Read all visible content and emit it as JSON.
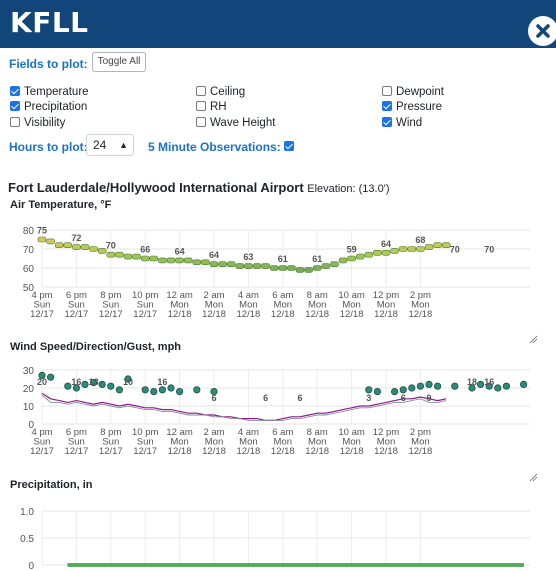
{
  "header": {
    "title": "KFLL",
    "close_icon": "close-circle-icon"
  },
  "fields": {
    "label": "Fields to plot:",
    "toggle_label": "Toggle All",
    "items": [
      {
        "label": "Temperature",
        "checked": true
      },
      {
        "label": "Ceiling",
        "checked": false
      },
      {
        "label": "Dewpoint",
        "checked": false
      },
      {
        "label": "Precipitation",
        "checked": true
      },
      {
        "label": "RH",
        "checked": false
      },
      {
        "label": "Pressure",
        "checked": true
      },
      {
        "label": "Visibility",
        "checked": false
      },
      {
        "label": "Wave Height",
        "checked": false
      },
      {
        "label": "Wind",
        "checked": true
      }
    ]
  },
  "hours": {
    "label": "Hours to plot:",
    "value": "24",
    "five_min_label": "5 Minute Observations:",
    "five_min_checked": true
  },
  "station": {
    "name": "Fort Lauderdale/Hollywood International Airport",
    "elevation": "Elevation: (13.0')"
  },
  "x_ticks": [
    [
      "4 pm",
      "Sun",
      "12/17"
    ],
    [
      "6 pm",
      "Sun",
      "12/17"
    ],
    [
      "8 pm",
      "Sun",
      "12/17"
    ],
    [
      "10 pm",
      "Sun",
      "12/17"
    ],
    [
      "12 am",
      "Mon",
      "12/18"
    ],
    [
      "2 am",
      "Mon",
      "12/18"
    ],
    [
      "4 am",
      "Mon",
      "12/18"
    ],
    [
      "6 am",
      "Mon",
      "12/18"
    ],
    [
      "8 am",
      "Mon",
      "12/18"
    ],
    [
      "10 am",
      "Mon",
      "12/18"
    ],
    [
      "12 pm",
      "Mon",
      "12/18"
    ],
    [
      "2 pm",
      "Mon",
      "12/18"
    ]
  ],
  "chart_data": [
    {
      "type": "scatter",
      "title": "Air Temperature, °F",
      "ylim": [
        50,
        80
      ],
      "yticks": [
        50,
        60,
        70,
        80
      ],
      "x_hours": [
        0,
        0.5,
        1,
        1.5,
        2,
        2.5,
        3,
        3.5,
        4,
        4.5,
        5,
        5.5,
        6,
        6.5,
        7,
        7.5,
        8,
        8.5,
        9,
        9.5,
        10,
        10.5,
        11,
        11.5,
        12,
        12.5,
        13,
        13.5,
        14,
        14.5,
        15,
        15.5,
        16,
        16.5,
        17,
        17.5,
        18,
        18.5,
        19,
        19.5,
        20,
        20.5,
        21,
        21.5,
        22,
        22.5,
        23,
        23.5
      ],
      "values": [
        75,
        74,
        72,
        72,
        71,
        71,
        70,
        69,
        67,
        67,
        66,
        66,
        65,
        65,
        64,
        64,
        64,
        64,
        63,
        63,
        62,
        62,
        62,
        61,
        61,
        61,
        61,
        60,
        60,
        60,
        59,
        59,
        60,
        61,
        62,
        64,
        65,
        66,
        67,
        68,
        68,
        69,
        70,
        70,
        70,
        71,
        72,
        72
      ],
      "labels": [
        {
          "x": 0,
          "text": "75"
        },
        {
          "x": 2,
          "text": "72"
        },
        {
          "x": 4,
          "text": "70"
        },
        {
          "x": 6,
          "text": "66"
        },
        {
          "x": 8,
          "text": "64"
        },
        {
          "x": 10,
          "text": "64"
        },
        {
          "x": 12,
          "text": "63"
        },
        {
          "x": 14,
          "text": "61"
        },
        {
          "x": 16,
          "text": "61"
        },
        {
          "x": 18,
          "text": "59"
        },
        {
          "x": 20,
          "text": "64"
        },
        {
          "x": 22,
          "text": "68"
        },
        {
          "x": 24,
          "text": "70"
        },
        {
          "x": 26,
          "text": "70"
        }
      ]
    },
    {
      "type": "line",
      "title": "Wind Speed/Direction/Gust, mph",
      "ylim": [
        0,
        30
      ],
      "yticks": [
        0,
        10,
        20,
        30
      ],
      "x_hours": [
        0,
        0.5,
        1,
        1.5,
        2,
        2.5,
        3,
        3.5,
        4,
        4.5,
        5,
        5.5,
        6,
        6.5,
        7,
        7.5,
        8,
        8.5,
        9,
        9.5,
        10,
        10.5,
        11,
        11.5,
        12,
        12.5,
        13,
        13.5,
        14,
        14.5,
        15,
        15.5,
        16,
        16.5,
        17,
        17.5,
        18,
        18.5,
        19,
        19.5,
        20,
        20.5,
        21,
        21.5,
        22,
        22.5,
        23,
        23.5
      ],
      "series": [
        {
          "values": [
            17,
            14,
            13,
            12,
            13,
            12,
            11,
            12,
            11,
            10,
            11,
            10,
            9,
            9,
            8,
            8,
            7,
            6,
            6,
            5,
            5,
            4,
            4,
            3,
            3,
            3,
            2,
            2,
            3,
            4,
            4,
            5,
            6,
            6,
            7,
            8,
            9,
            10,
            10,
            11,
            12,
            13,
            14,
            14,
            15,
            14,
            13,
            14
          ]
        },
        {
          "values": [
            16,
            12,
            12,
            11,
            12,
            11,
            10,
            11,
            10,
            9,
            10,
            9,
            8,
            8,
            7,
            7,
            6,
            5,
            5,
            5,
            4,
            4,
            3,
            3,
            2,
            2,
            2,
            2,
            2,
            3,
            3,
            4,
            5,
            5,
            6,
            7,
            8,
            9,
            9,
            10,
            11,
            12,
            12,
            13,
            14,
            12,
            12,
            13
          ]
        }
      ],
      "gusts": [
        [
          0,
          27
        ],
        [
          0.5,
          26
        ],
        [
          1.5,
          21
        ],
        [
          2,
          20
        ],
        [
          2.5,
          22
        ],
        [
          3,
          23
        ],
        [
          3.5,
          22
        ],
        [
          4,
          21
        ],
        [
          4.5,
          19
        ],
        [
          5,
          25
        ],
        [
          6,
          19
        ],
        [
          6.5,
          18
        ],
        [
          7,
          19
        ],
        [
          7.5,
          20
        ],
        [
          8,
          18
        ],
        [
          9,
          19
        ],
        [
          10,
          18
        ],
        [
          19,
          19
        ],
        [
          19.5,
          18
        ],
        [
          20.5,
          18
        ],
        [
          21,
          19
        ],
        [
          21.5,
          20
        ],
        [
          22,
          21
        ],
        [
          22.5,
          22
        ],
        [
          23,
          21
        ],
        [
          24,
          21
        ],
        [
          25,
          20
        ],
        [
          25.5,
          22
        ],
        [
          26,
          21
        ],
        [
          26.5,
          20
        ],
        [
          27,
          21
        ],
        [
          28,
          22
        ]
      ],
      "labels": [
        {
          "x": 0,
          "text": "20"
        },
        {
          "x": 2,
          "text": "16"
        },
        {
          "x": 3,
          "text": "13"
        },
        {
          "x": 5,
          "text": "10"
        },
        {
          "x": 7,
          "text": "16"
        },
        {
          "x": 10,
          "text": "6"
        },
        {
          "x": 13,
          "text": "6"
        },
        {
          "x": 15,
          "text": "6"
        },
        {
          "x": 19,
          "text": "3"
        },
        {
          "x": 21,
          "text": "6"
        },
        {
          "x": 22.5,
          "text": "9"
        },
        {
          "x": 25,
          "text": "18"
        },
        {
          "x": 26,
          "text": "16"
        }
      ]
    },
    {
      "type": "bar",
      "title": "Precipitation, in",
      "ylim": [
        0,
        1.0
      ],
      "yticks": [
        "0",
        "0.5",
        "1.0"
      ],
      "values": [
        0
      ]
    }
  ]
}
